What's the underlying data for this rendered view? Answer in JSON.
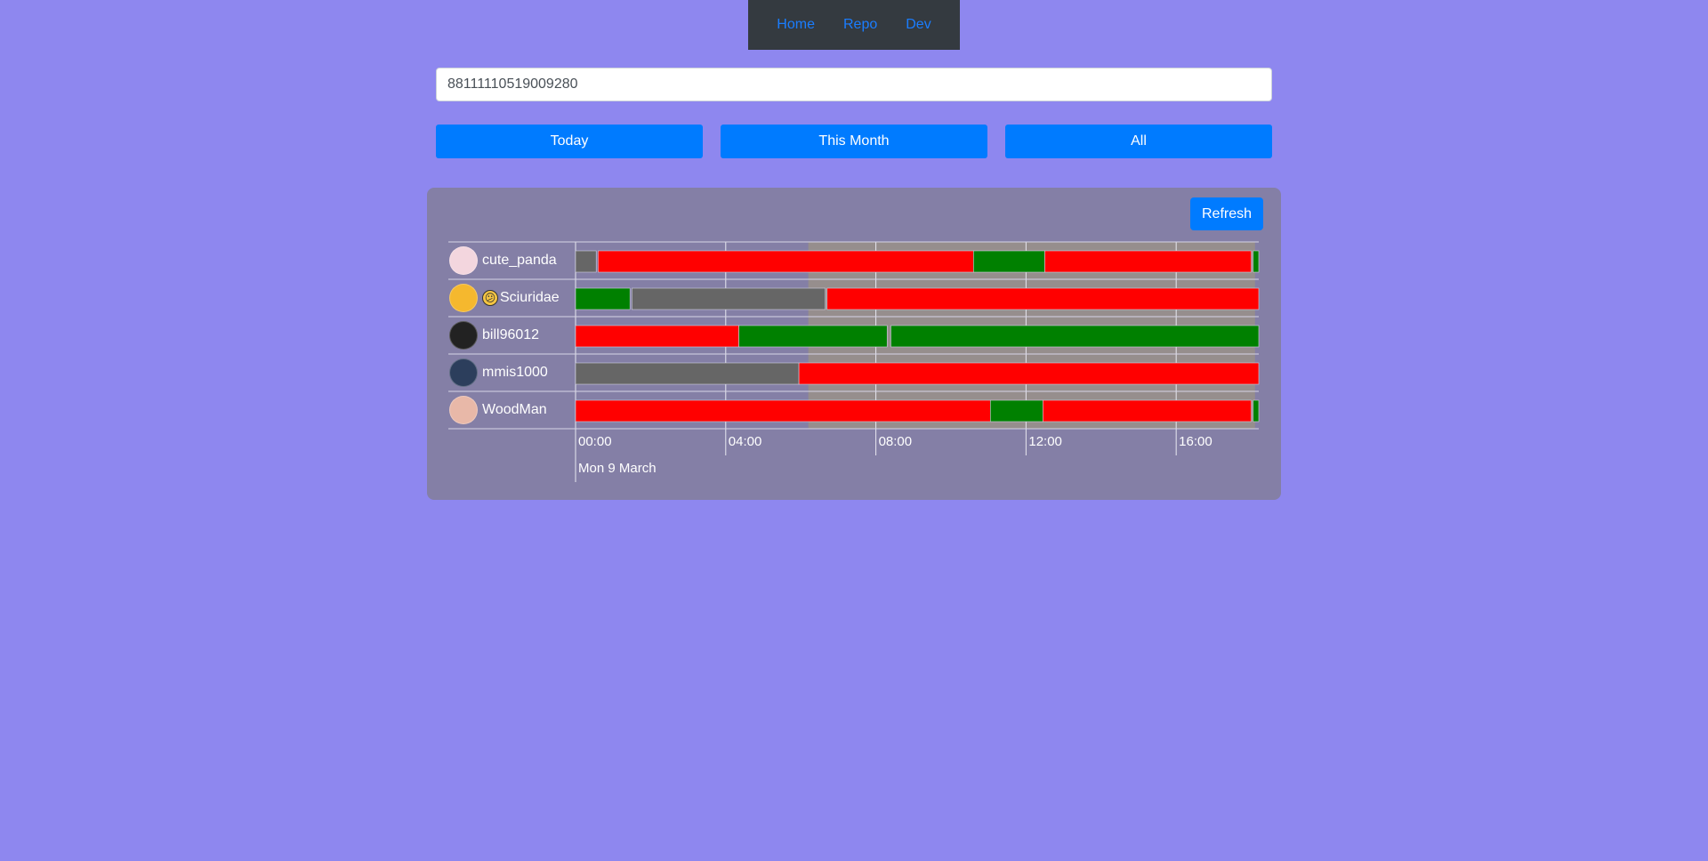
{
  "nav": {
    "items": [
      "Home",
      "Repo",
      "Dev"
    ]
  },
  "search": {
    "value": "88111110519009280"
  },
  "buttons": {
    "today": "Today",
    "this_month": "This Month",
    "all": "All"
  },
  "timeline": {
    "refresh_label": "Refresh",
    "date_label": "Mon 9 March",
    "tick_labels": [
      "00:00",
      "04:00",
      "08:00",
      "12:00",
      "16:00"
    ],
    "visible_range_hours": [
      0,
      18.2
    ],
    "highlight_range_hours": [
      6.2,
      18.1
    ],
    "colors": {
      "offline": "#666666",
      "online": "#ff0000",
      "playing": "#008000",
      "highlight": "#9c9384"
    },
    "users": [
      {
        "name": "cute_panda",
        "avatar_color": "#f3d6de",
        "status_emoji": "",
        "segments": [
          [
            0,
            0.55,
            "offline"
          ],
          [
            0.6,
            10.6,
            "online"
          ],
          [
            10.6,
            12.5,
            "playing"
          ],
          [
            12.5,
            18.0,
            "online"
          ],
          [
            18.05,
            18.2,
            "playing"
          ]
        ]
      },
      {
        "name": "Sciuridae",
        "avatar_color": "#f5b82e",
        "status_emoji": "😕",
        "segments": [
          [
            0,
            1.45,
            "playing"
          ],
          [
            1.5,
            6.65,
            "offline"
          ],
          [
            6.7,
            18.2,
            "online"
          ]
        ]
      },
      {
        "name": "bill96012",
        "avatar_color": "#222222",
        "status_emoji": "",
        "segments": [
          [
            0,
            4.35,
            "online"
          ],
          [
            4.35,
            8.3,
            "playing"
          ],
          [
            8.4,
            18.2,
            "playing"
          ]
        ]
      },
      {
        "name": "mmis1000",
        "avatar_color": "#2c3e5c",
        "status_emoji": "",
        "segments": [
          [
            0,
            5.95,
            "offline"
          ],
          [
            5.95,
            18.2,
            "online"
          ]
        ]
      },
      {
        "name": "WoodMan",
        "avatar_color": "#e8b8a8",
        "status_emoji": "",
        "segments": [
          [
            0,
            11.05,
            "online"
          ],
          [
            11.05,
            12.45,
            "playing"
          ],
          [
            12.45,
            18.0,
            "online"
          ],
          [
            18.05,
            18.2,
            "playing"
          ]
        ]
      }
    ]
  }
}
